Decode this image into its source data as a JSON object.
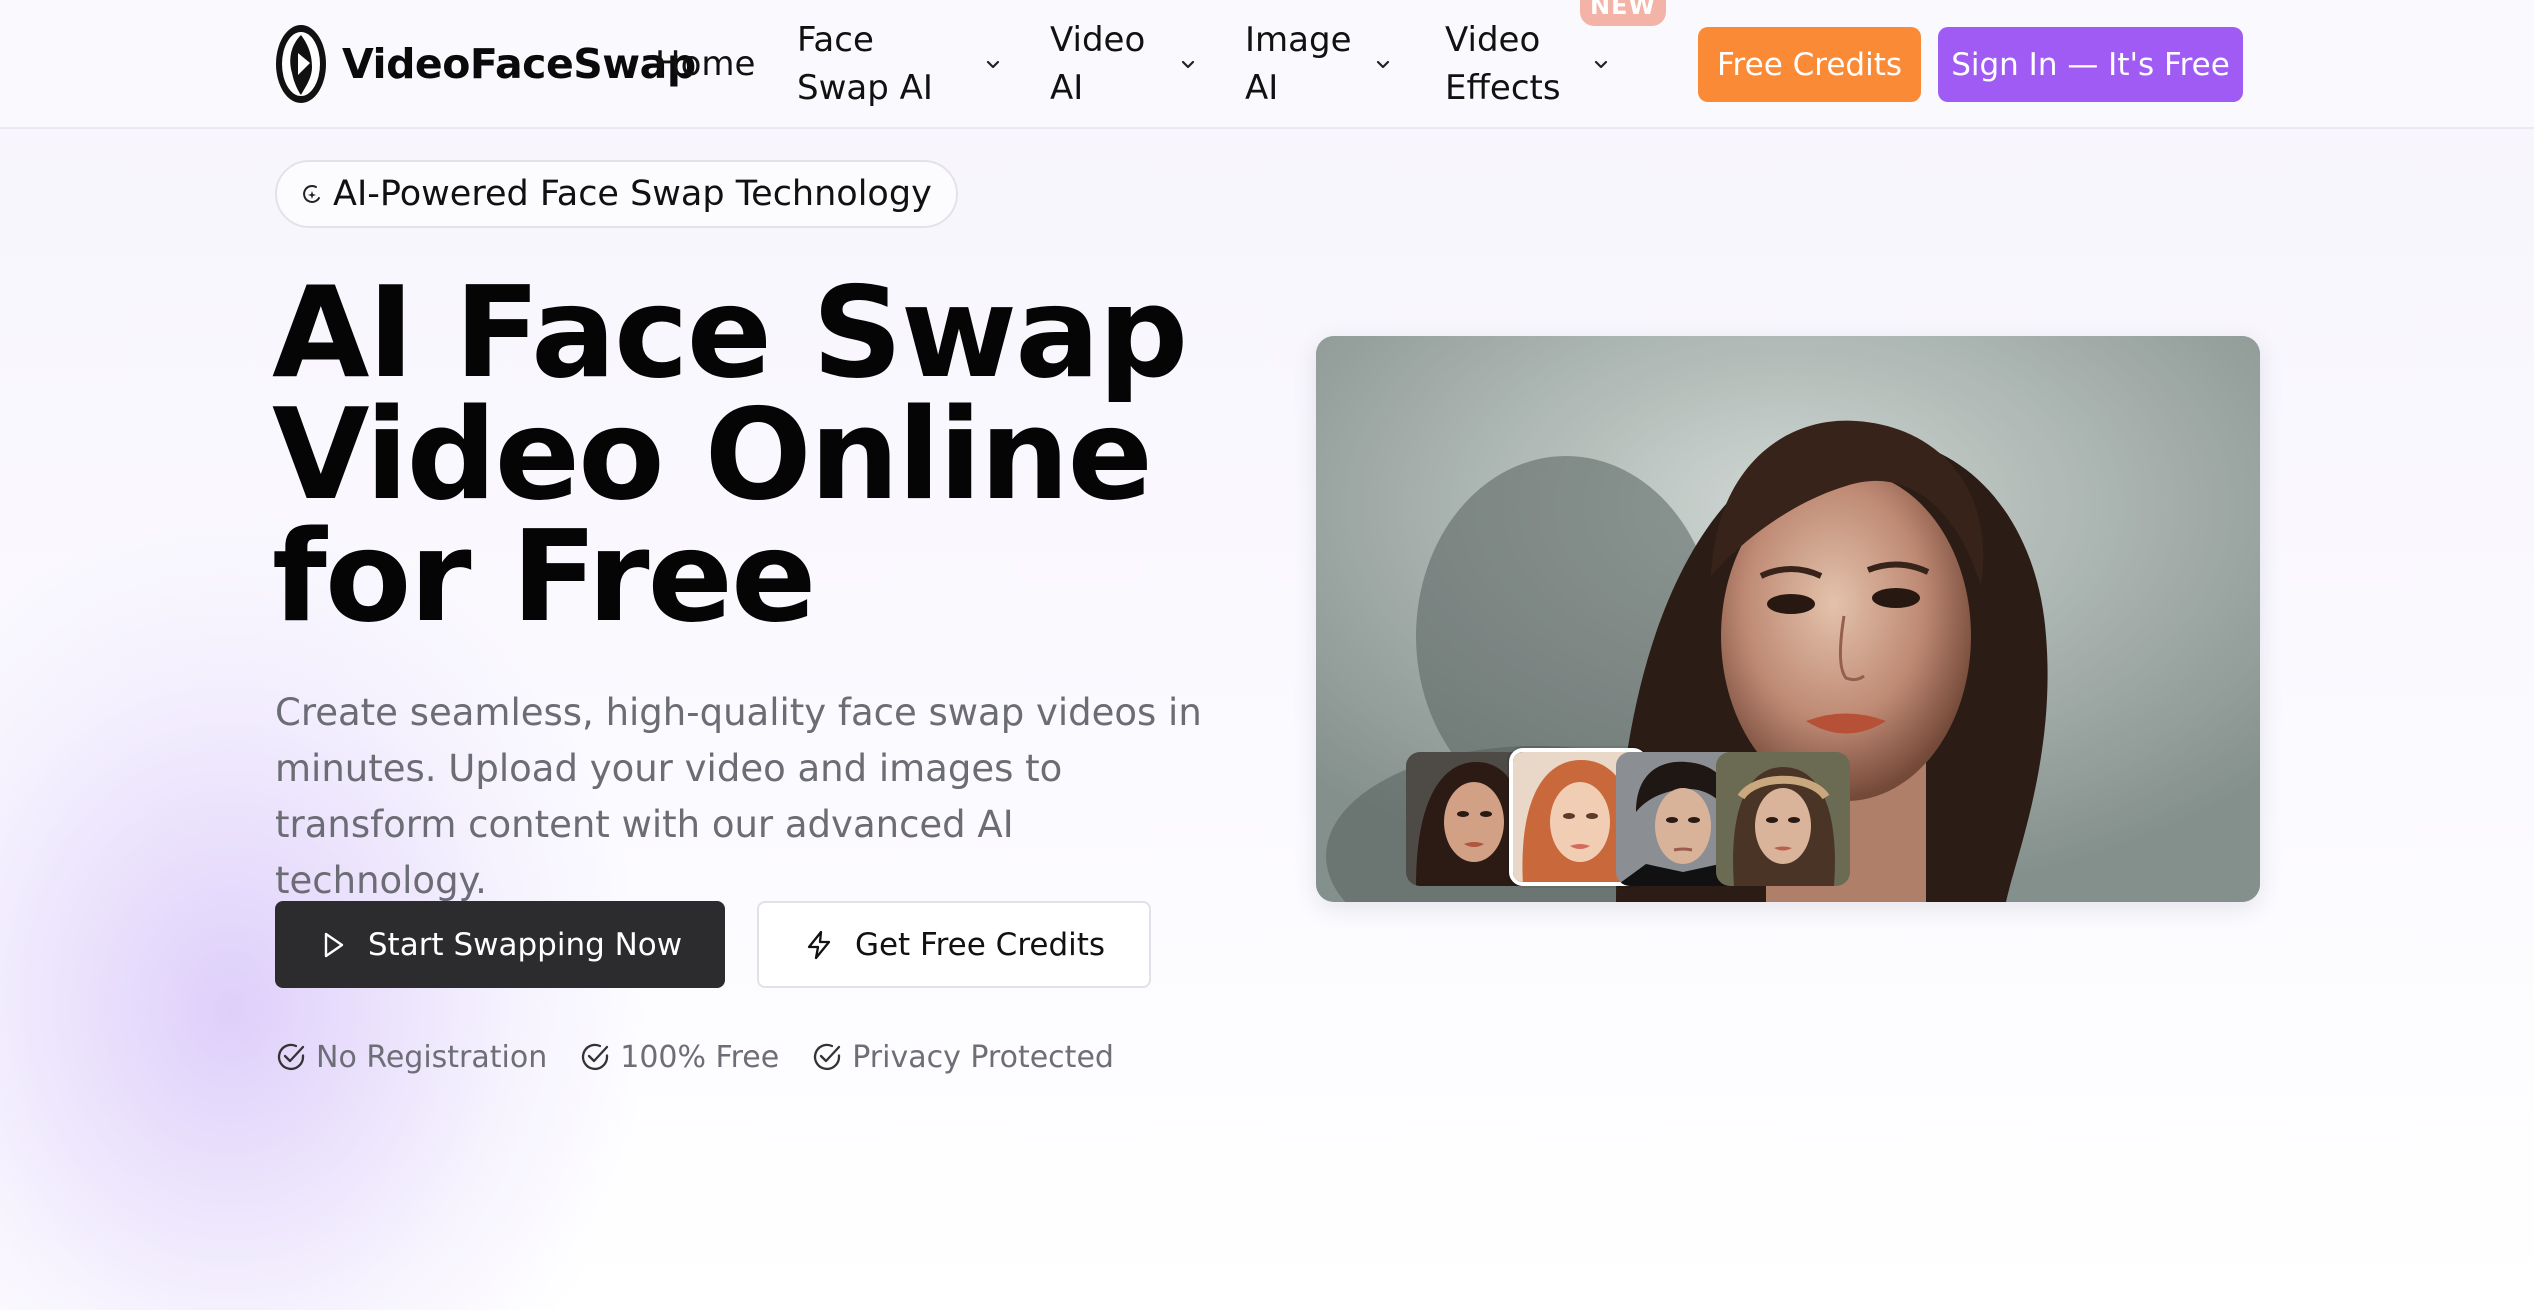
{
  "brand": {
    "name": "VideoFaceSwap"
  },
  "nav": {
    "home": "Home",
    "face_swap_ai": "Face Swap AI",
    "video_ai": "Video AI",
    "image_ai": "Image AI",
    "video_effects": "Video Effects",
    "new_badge": "NEW"
  },
  "header_buttons": {
    "free_credits": "Free Credits",
    "sign_in": "Sign In — It's Free"
  },
  "hero": {
    "badge": "AI-Powered Face Swap Technology",
    "title_lines": [
      "AI Face Swap",
      "Video Online",
      "for Free"
    ],
    "description": "Create seamless, high-quality face swap videos in minutes. Upload your video and images to transform content with our advanced AI technology.",
    "primary_button": "Start Swapping Now",
    "secondary_button": "Get Free Credits",
    "features": [
      "No Registration",
      "100% Free",
      "Privacy Protected"
    ]
  },
  "media": {
    "selected_thumbnail": 2,
    "thumbnail_count": 4
  },
  "colors": {
    "accent_orange": "#fb8a36",
    "accent_purple": "#a15bf5",
    "dark_button": "#2c2c2f",
    "new_badge": "#f3b3a7"
  },
  "icons": [
    "logo-icon",
    "chevron-down-icon",
    "sparkle-icon",
    "play-icon",
    "lightning-icon",
    "check-circle-icon"
  ]
}
